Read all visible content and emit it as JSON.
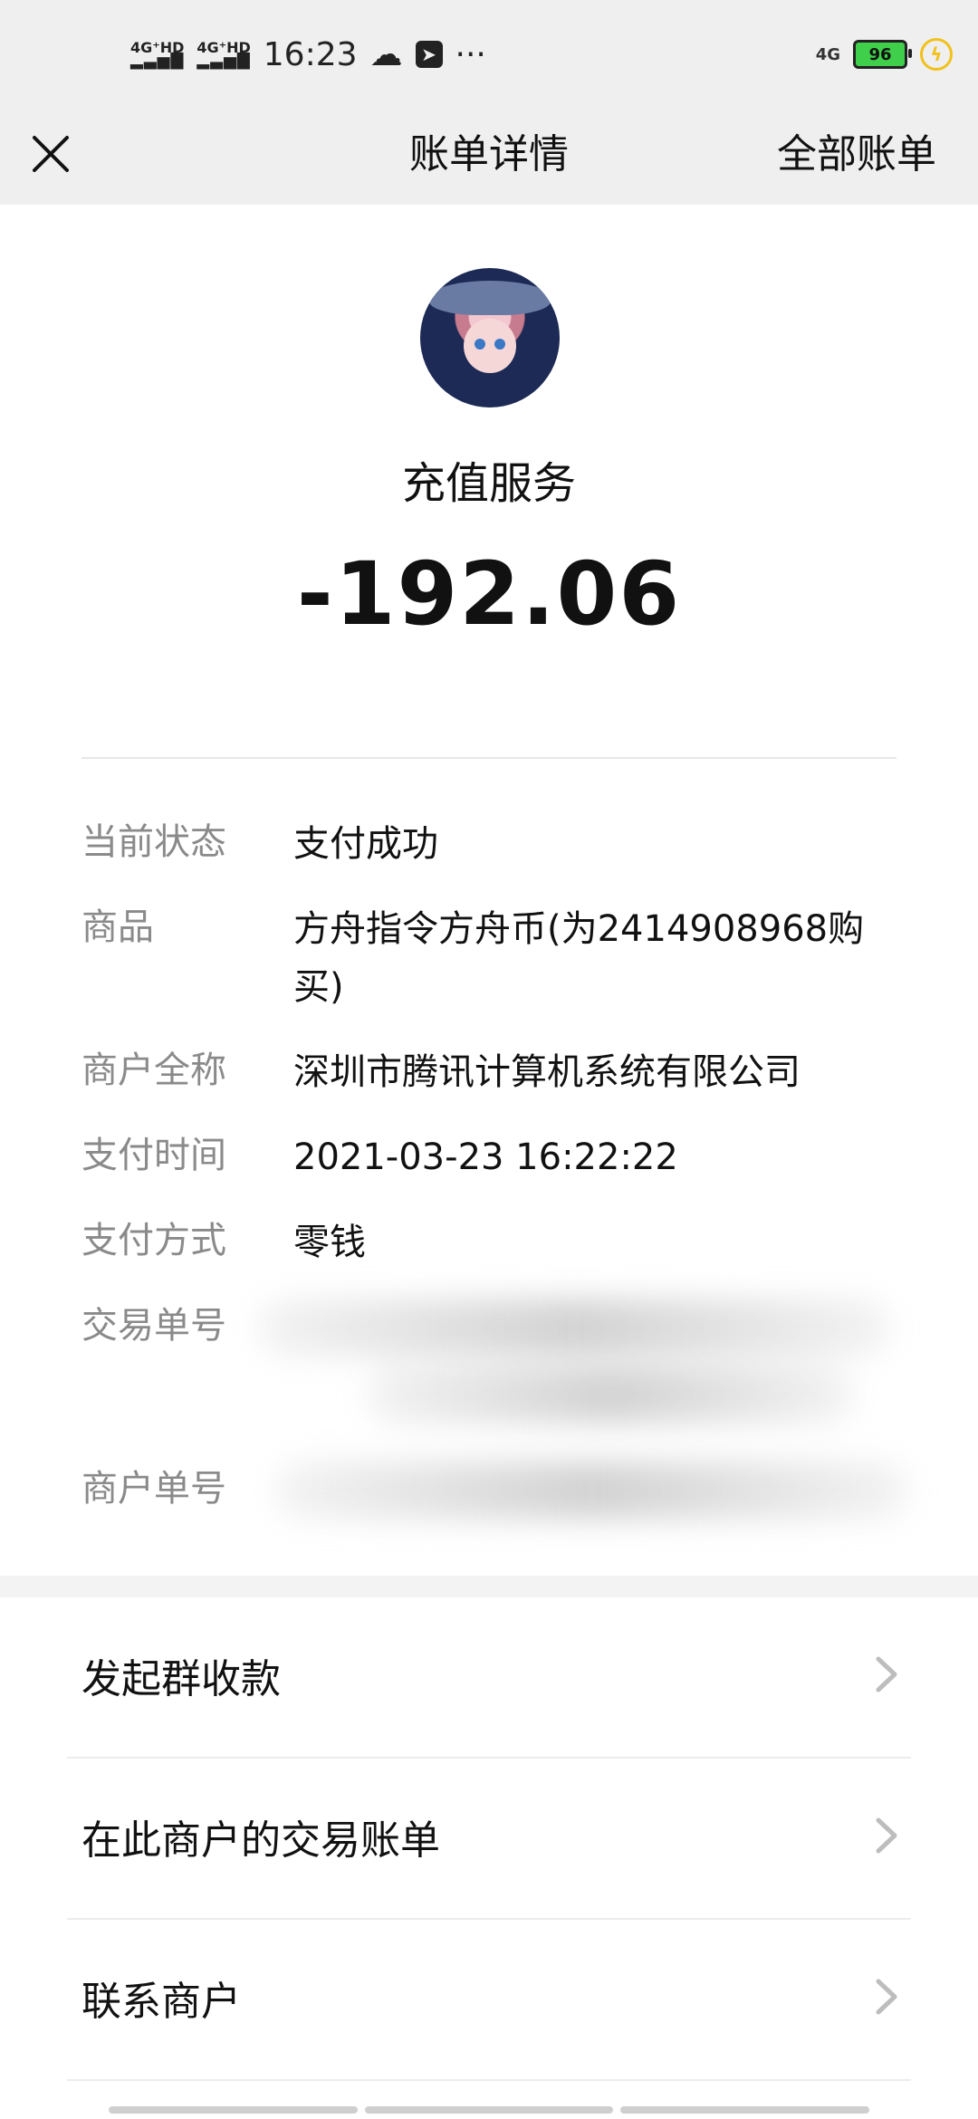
{
  "status_bar": {
    "time": "16:23",
    "signal1": "4G⁺HD",
    "signal2": "4G⁺HD",
    "network": "4G",
    "battery": "96"
  },
  "title_bar": {
    "title": "账单详情",
    "right_action": "全部账单"
  },
  "header": {
    "merchant_name": "充值服务",
    "amount": "-192.06"
  },
  "details": [
    {
      "label": "当前状态",
      "value": "支付成功"
    },
    {
      "label": "商品",
      "value": "方舟指令方舟币(为2414908968购买)"
    },
    {
      "label": "商户全称",
      "value": "深圳市腾讯计算机系统有限公司"
    },
    {
      "label": "支付时间",
      "value": "2021-03-23 16:22:22"
    },
    {
      "label": "支付方式",
      "value": "零钱"
    },
    {
      "label": "交易单号",
      "value": ""
    },
    {
      "label": "商户单号",
      "value": ""
    }
  ],
  "actions": [
    {
      "label": "发起群收款"
    },
    {
      "label": "在此商户的交易账单"
    },
    {
      "label": "联系商户"
    }
  ],
  "icons": {
    "close": "close-icon",
    "chevron": "chevron-right-icon",
    "weather": "cloud-icon",
    "app": "telegram-icon",
    "more": "more-dots-icon",
    "charging": "bolt-icon"
  }
}
